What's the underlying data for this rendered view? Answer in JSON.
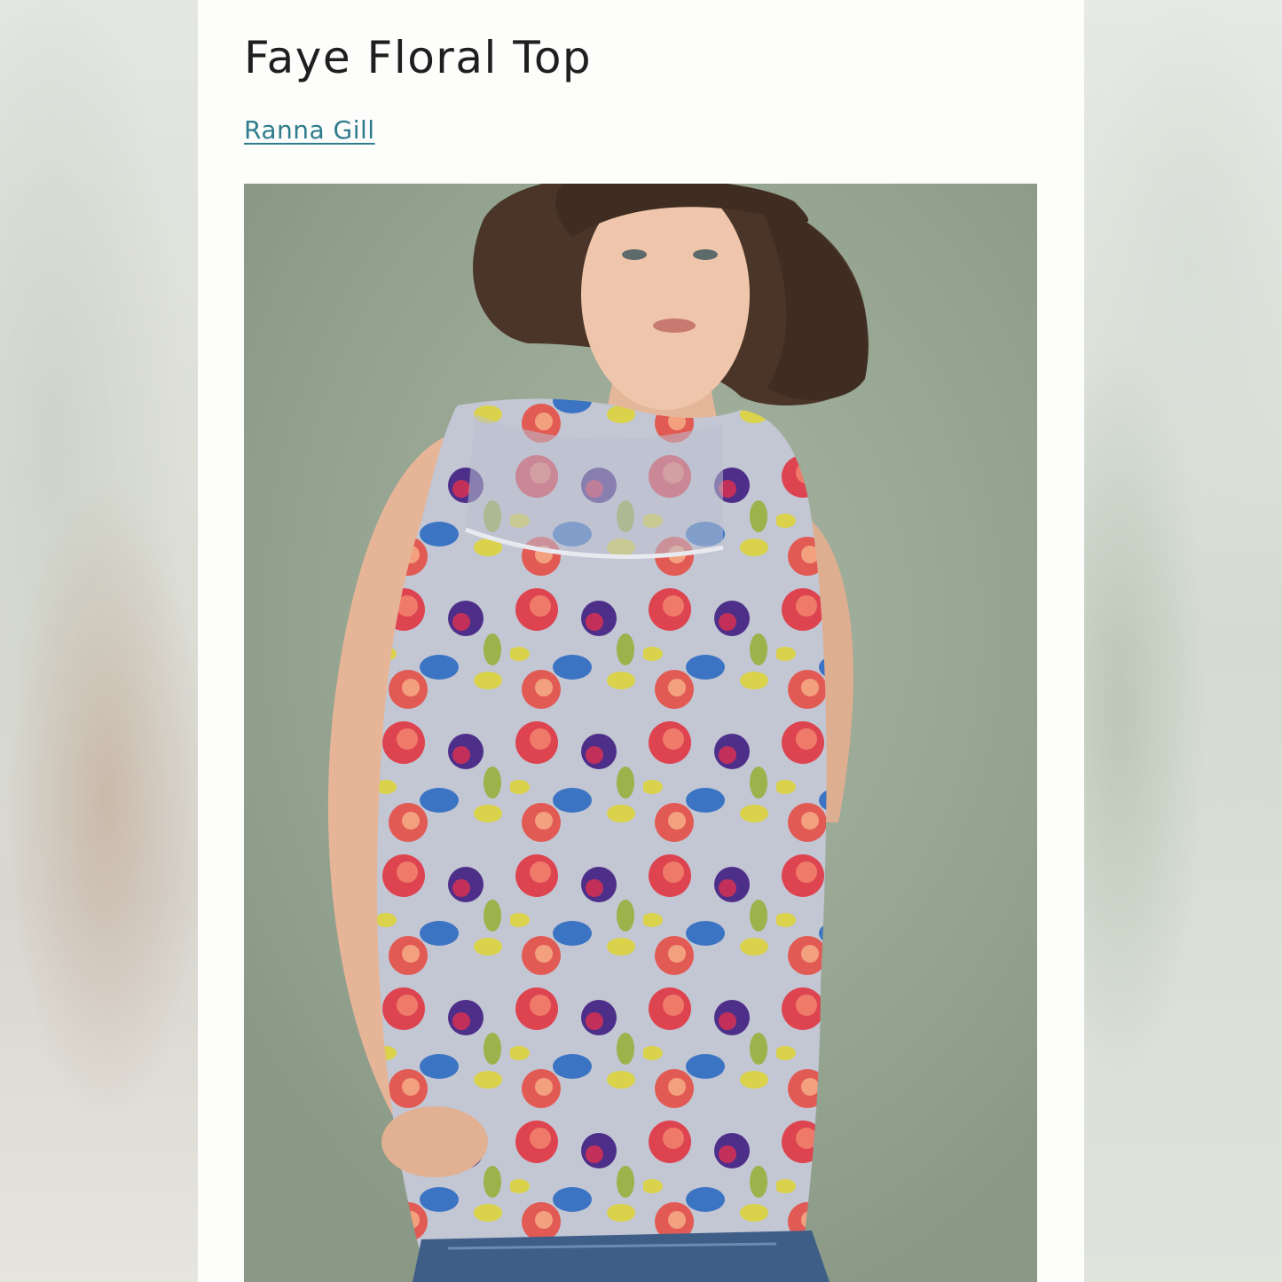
{
  "product": {
    "title": "Faye Floral Top",
    "brand": "Ranna Gill"
  },
  "image": {
    "icon": "product-photo",
    "description_colors": {
      "background": "#9aa894",
      "fabric": "#bfc3d0",
      "accent_red": "#d8344a",
      "accent_blue": "#3c74c4",
      "accent_yellow": "#d9d24a",
      "accent_purple": "#4d2f8a"
    }
  },
  "colors": {
    "link": "#2e7c8c",
    "title": "#1f1f1f",
    "page": "#fdfdfb"
  }
}
